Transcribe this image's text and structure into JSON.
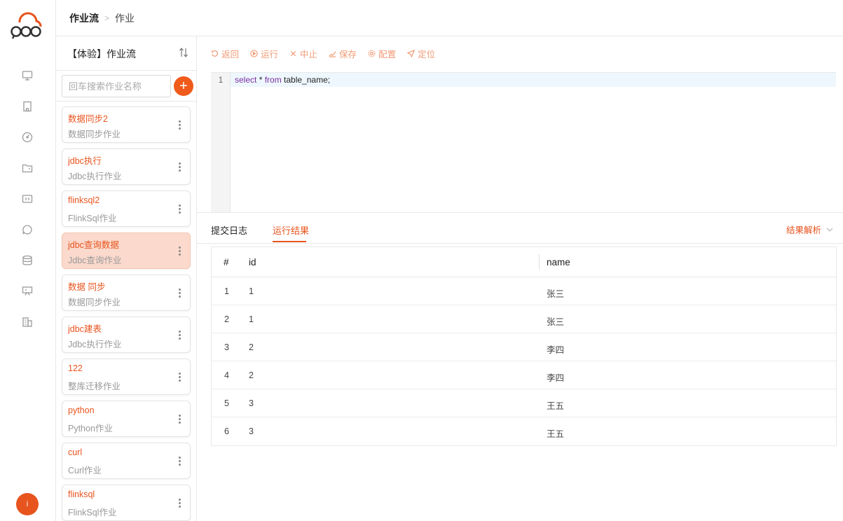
{
  "brand": {
    "accent": "#e8541e",
    "add_button_color": "#f05a1a",
    "active_card_bg": "#fbd9cc"
  },
  "header": {
    "breadcrumb_root": "作业流",
    "breadcrumb_current": "作业"
  },
  "rail": {
    "icons": [
      "monitor-icon",
      "building-icon",
      "gauge-icon",
      "folder-icon",
      "calendar-icon",
      "chat-icon",
      "database-icon",
      "presentation-icon",
      "city-icon"
    ],
    "avatar_text": "i"
  },
  "panel": {
    "title": "【体验】作业流",
    "search_placeholder": "回车搜索作业名称",
    "add_label": "+",
    "jobs": [
      {
        "name": "数据同步2",
        "type": "数据同步作业",
        "active": false
      },
      {
        "name": "jdbc执行",
        "type": "Jdbc执行作业",
        "active": false
      },
      {
        "name": "flinksql2",
        "type": "FlinkSql作业",
        "active": false
      },
      {
        "name": "jdbc查询数据",
        "type": "Jdbc查询作业",
        "active": true
      },
      {
        "name": "数据 同步",
        "type": "数据同步作业",
        "active": false
      },
      {
        "name": "jdbc建表",
        "type": "Jdbc执行作业",
        "active": false
      },
      {
        "name": "122",
        "type": "整库迁移作业",
        "active": false
      },
      {
        "name": "python",
        "type": "Python作业",
        "active": false
      },
      {
        "name": "curl",
        "type": "Curl作业",
        "active": false
      },
      {
        "name": "flinksql",
        "type": "FlinkSql作业",
        "active": false
      }
    ]
  },
  "toolbar": {
    "back": "返回",
    "run": "运行",
    "stop": "中止",
    "save": "保存",
    "config": "配置",
    "locate": "定位"
  },
  "editor": {
    "line_number": "1",
    "kw_select": "select",
    "code_mid": " * ",
    "kw_from": "from",
    "code_tail": " table_name;"
  },
  "result": {
    "tab_log": "提交日志",
    "tab_result": "运行结果",
    "parse_label": "结果解析",
    "columns": {
      "index": "#",
      "id": "id",
      "name": "name"
    },
    "rows": [
      {
        "index": "1",
        "id": "1",
        "name": "张三"
      },
      {
        "index": "2",
        "id": "1",
        "name": "张三"
      },
      {
        "index": "3",
        "id": "2",
        "name": "李四"
      },
      {
        "index": "4",
        "id": "2",
        "name": "李四"
      },
      {
        "index": "5",
        "id": "3",
        "name": "王五"
      },
      {
        "index": "6",
        "id": "3",
        "name": "王五"
      }
    ]
  }
}
